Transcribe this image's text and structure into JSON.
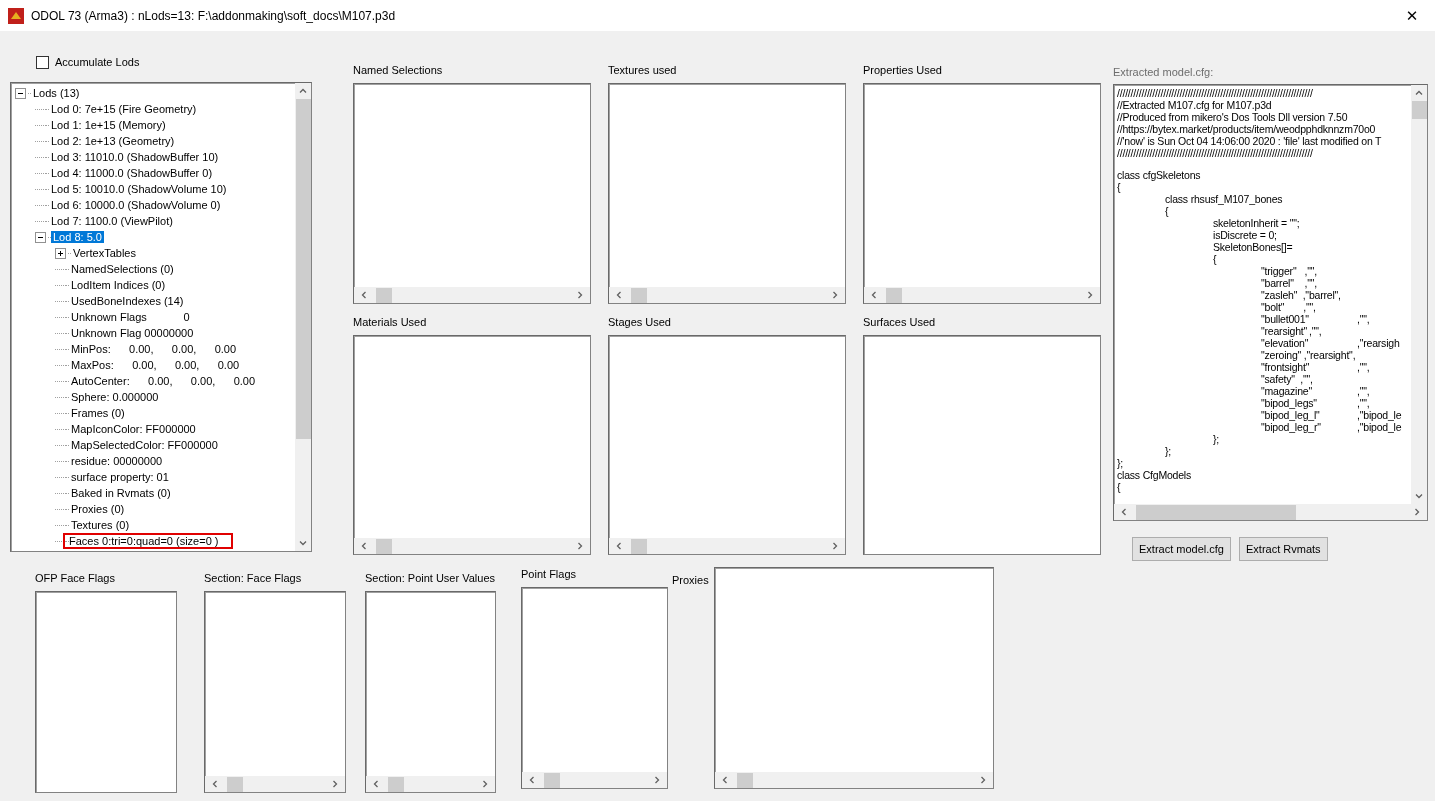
{
  "window": {
    "title": "ODOL 73 (Arma3) : nLods=13: F:\\addonmaking\\soft_docs\\M107.p3d",
    "close": "✕"
  },
  "accumulate_lods": {
    "label": "Accumulate Lods",
    "checked": false
  },
  "tree": {
    "items": [
      {
        "label": "Lods (13)",
        "selected": false,
        "expanded": true,
        "children": [
          {
            "label": "Lod 0: 7e+15 (Fire Geometry)",
            "selected": false
          },
          {
            "label": "Lod 1: 1e+15 (Memory)",
            "selected": false
          },
          {
            "label": "Lod 2: 1e+13 (Geometry)",
            "selected": false
          },
          {
            "label": "Lod 3: 11010.0 (ShadowBuffer 10)",
            "selected": false
          },
          {
            "label": "Lod 4: 11000.0 (ShadowBuffer 0)",
            "selected": false
          },
          {
            "label": "Lod 5: 10010.0 (ShadowVolume 10)",
            "selected": false
          },
          {
            "label": "Lod 6: 10000.0 (ShadowVolume 0)",
            "selected": false
          },
          {
            "label": "Lod 7: 1100.0 (ViewPilot)",
            "selected": false
          },
          {
            "label": "Lod 8: 5.0",
            "selected": true,
            "expanded": true,
            "children": [
              {
                "label": "VertexTables",
                "selected": false,
                "expanded": false
              },
              {
                "label": "NamedSelections (0)",
                "selected": false
              },
              {
                "label": "LodItem Indices (0)",
                "selected": false
              },
              {
                "label": "UsedBoneIndexes (14)",
                "selected": false
              },
              {
                "label": "Unknown Flags            0",
                "selected": false
              },
              {
                "label": "Unknown Flag 00000000",
                "selected": false
              },
              {
                "label": "MinPos:      0.00,      0.00,      0.00",
                "selected": false
              },
              {
                "label": "MaxPos:      0.00,      0.00,      0.00",
                "selected": false
              },
              {
                "label": "AutoCenter:      0.00,      0.00,      0.00",
                "selected": false
              },
              {
                "label": "Sphere: 0.000000",
                "selected": false
              },
              {
                "label": "Frames (0)",
                "selected": false
              },
              {
                "label": "MapIconColor: FF000000",
                "selected": false
              },
              {
                "label": "MapSelectedColor: FF000000",
                "selected": false
              },
              {
                "label": "residue: 00000000",
                "selected": false
              },
              {
                "label": "surface property: 01",
                "selected": false
              },
              {
                "label": "Baked in Rvmats (0)",
                "selected": false
              },
              {
                "label": "Proxies (0)",
                "selected": false
              },
              {
                "label": "Textures (0)",
                "selected": false
              },
              {
                "label": "Faces 0:tri=0:quad=0 (size=0 )",
                "selected": false,
                "highlighted": true
              }
            ]
          }
        ]
      }
    ]
  },
  "lists": [
    {
      "label": "Named Selections",
      "scrollbar": true
    },
    {
      "label": "Textures used",
      "scrollbar": true
    },
    {
      "label": "Properties Used",
      "scrollbar": true
    },
    {
      "label": "Materials Used",
      "scrollbar": true
    },
    {
      "label": "Stages Used",
      "scrollbar": true
    },
    {
      "label": "Surfaces Used",
      "scrollbar": false
    }
  ],
  "model_cfg": {
    "label": "Extracted model.cfg:",
    "disabled": true,
    "header": [
      "////////////////////////////////////////////////////////////////////////",
      "//Extracted M107.cfg for M107.p3d",
      "//Produced from mikero's Dos Tools Dll version 7.50",
      "//https://bytex.market/products/item/weodpphdknnzm70o0",
      "//'now' is Sun Oct 04 14:06:00 2020 : 'file' last modified on T",
      "////////////////////////////////////////////////////////////////////////"
    ],
    "lines": [
      "class cfgSkeletons",
      "{",
      "\tclass rhsusf_M107_bones",
      "\t{",
      "\t\tskeletonInherit = \"\";",
      "\t\tisDiscrete = 0;",
      "\t\tSkeletonBones[]=",
      "\t\t{",
      "\t\t\t\"trigger\"   ,\"\",",
      "\t\t\t\"barrel\"    ,\"\",",
      "\t\t\t\"zasleh\"  ,\"barrel\",",
      "\t\t\t\"bolt\"       ,\"\",",
      "\t\t\t\"bullet001\"\t,\"\",",
      "\t\t\t\"rearsight\"\t,\"\",",
      "\t\t\t\"elevation\"\t,\"rearsigh",
      "\t\t\t\"zeroing\" ,\"rearsight\",",
      "\t\t\t\"frontsight\"\t,\"\",",
      "\t\t\t\"safety\"  ,\"\",",
      "\t\t\t\"magazine\"\t,\"\",",
      "\t\t\t\"bipod_legs\"\t,\"\",",
      "\t\t\t\"bipod_leg_l\"\t,\"bipod_le",
      "\t\t\t\"bipod_leg_r\"\t,\"bipod_le",
      "\t\t};",
      "\t};",
      "};",
      "class CfgModels",
      "{"
    ]
  },
  "buttons": [
    "Extract model.cfg",
    "Extract Rvmats"
  ],
  "bottom_lists": [
    {
      "label": "OFP Face Flags",
      "scrollbar": false
    },
    {
      "label": "Section: Face Flags",
      "scrollbar": true
    },
    {
      "label": "Section: Point User Values",
      "scrollbar": true
    },
    {
      "label": "Point Flags",
      "scrollbar": true
    }
  ],
  "proxies": {
    "label": "Proxies",
    "scrollbar": true
  }
}
